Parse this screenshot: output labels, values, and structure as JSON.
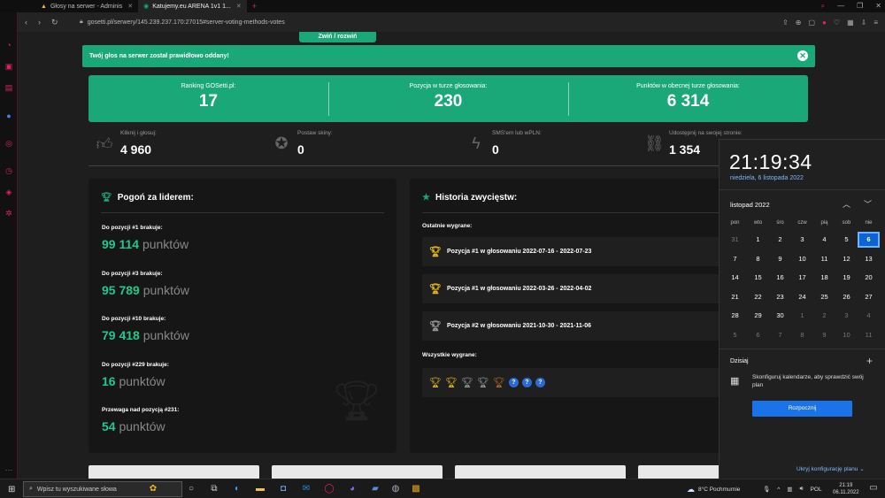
{
  "browser": {
    "tabs": [
      {
        "title": "Głosy na serwer - Adminis"
      },
      {
        "title": "Katujemy.eu ARENA 1v1 1..."
      }
    ],
    "new_tab": "+",
    "url": "gosetti.pl/serwery/145.239.237.170:27015#server-voting-methods-votes"
  },
  "page": {
    "collapse_label": "Zwiń / rozwiń",
    "alert_text": "Twój głos na serwer został prawidłowo oddany!",
    "green_stats": [
      {
        "label": "Ranking GOSetti.pl:",
        "value": "17"
      },
      {
        "label": "Pozycja w turze głosowania:",
        "value": "230"
      },
      {
        "label": "Punktów w obecnej turze głosowania:",
        "value": "6 314"
      }
    ],
    "small_stats": [
      {
        "label": "Kliknij i głosuj:",
        "value": "4 960",
        "icon": "thumbs-up-icon"
      },
      {
        "label": "Postaw skiny:",
        "value": "0",
        "icon": "award-icon"
      },
      {
        "label": "SMS'em lub wPLN:",
        "value": "0",
        "icon": "bolt-icon"
      },
      {
        "label": "Udostępnij na swojej stronie:",
        "value": "1 354",
        "icon": "link-icon"
      }
    ],
    "leader": {
      "title": "Pogoń za liderem:",
      "items": [
        {
          "label": "Do pozycji #1 brakuje:",
          "num": "99 114",
          "unit": "punktów"
        },
        {
          "label": "Do pozycji #3 brakuje:",
          "num": "95 789",
          "unit": "punktów"
        },
        {
          "label": "Do pozycji #10 brakuje:",
          "num": "79 418",
          "unit": "punktów"
        },
        {
          "label": "Do pozycji #229 brakuje:",
          "num": "16",
          "unit": "punktów"
        },
        {
          "label": "Przewaga nad pozycją #231:",
          "num": "54",
          "unit": "punktów"
        }
      ]
    },
    "history": {
      "title": "Historia zwycięstw:",
      "recent_label": "Ostatnie wygrane:",
      "recent": [
        {
          "text": "Pozycja #1 w głosowaniu 2022-07-16 - 2022-07-23",
          "medal": "gold"
        },
        {
          "text": "Pozycja #1 w głosowaniu 2022-03-26 - 2022-04-02",
          "medal": "gold"
        },
        {
          "text": "Pozycja #2 w głosowaniu 2021-10-30 - 2021-11-06",
          "medal": "silver"
        }
      ],
      "all_label": "Wszystkie wygrane:",
      "all": [
        "gold",
        "gold",
        "silver",
        "silver",
        "bronze",
        "unknown",
        "unknown",
        "unknown"
      ],
      "unknown_symbol": "?"
    }
  },
  "calendar": {
    "time": "21:19:34",
    "date": "niedziela, 6 listopada 2022",
    "month": "listopad 2022",
    "weekdays": [
      "pon",
      "wto",
      "śro",
      "czw",
      "pią",
      "sob",
      "nie"
    ],
    "weeks": [
      [
        "31",
        "1",
        "2",
        "3",
        "4",
        "5",
        "6"
      ],
      [
        "7",
        "8",
        "9",
        "10",
        "11",
        "12",
        "13"
      ],
      [
        "14",
        "15",
        "16",
        "17",
        "18",
        "19",
        "20"
      ],
      [
        "21",
        "22",
        "23",
        "24",
        "25",
        "26",
        "27"
      ],
      [
        "28",
        "29",
        "30",
        "1",
        "2",
        "3",
        "4"
      ],
      [
        "5",
        "6",
        "7",
        "8",
        "9",
        "10",
        "11"
      ]
    ],
    "today_index": [
      0,
      6
    ],
    "today_label": "Dzisiaj",
    "config_text": "Skonfiguruj kalendarze, aby sprawdzić swój plan",
    "start_button": "Rozpocznij",
    "hide_link": "Ukryj konfigurację planu"
  },
  "taskbar": {
    "search_placeholder": "Wpisz tu wyszukiwane słowa",
    "weather": "8°C  Pochmurnie",
    "lang": "POL",
    "time": "21:19",
    "date": "06.11.2022"
  },
  "colors": {
    "accent": "#1aa879",
    "accent_text": "#1ec98c",
    "windows_blue": "#0b63d6"
  }
}
